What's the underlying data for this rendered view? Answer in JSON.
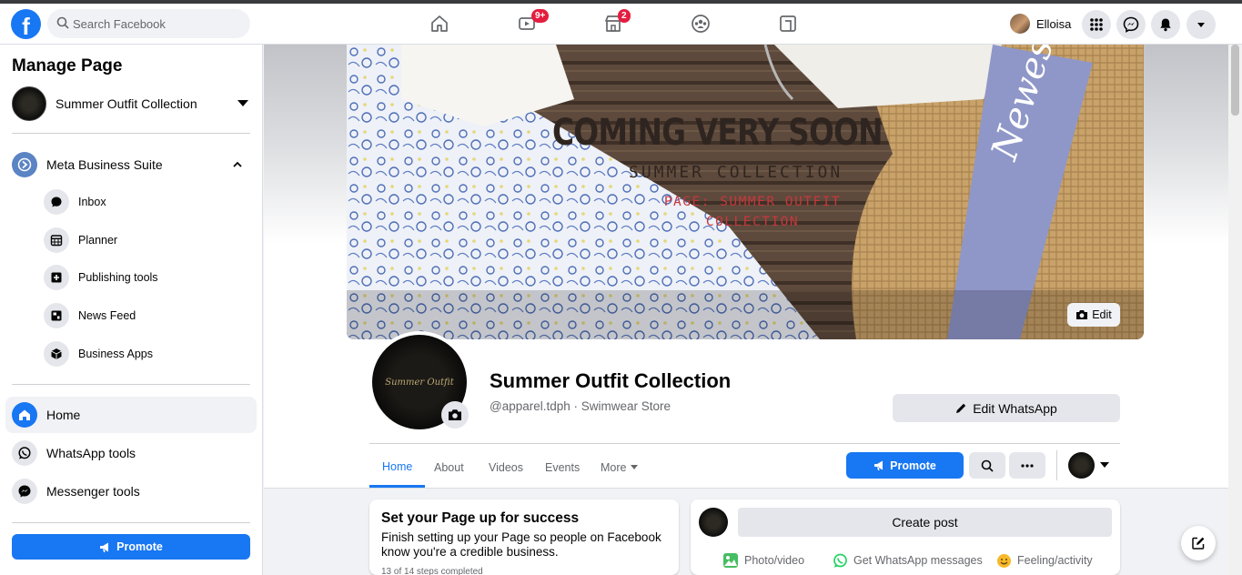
{
  "topbar": {
    "search_placeholder": "Search Facebook",
    "badges": {
      "watch": "9+",
      "marketplace": "2"
    },
    "user_name": "Elloisa"
  },
  "sidebar": {
    "title": "Manage Page",
    "page_name": "Summer Outfit Collection",
    "business_suite": "Meta Business Suite",
    "suite_items": [
      {
        "label": "Inbox",
        "icon": "chat-bubble-icon"
      },
      {
        "label": "Planner",
        "icon": "calendar-icon"
      },
      {
        "label": "Publishing tools",
        "icon": "publishing-icon"
      },
      {
        "label": "News Feed",
        "icon": "news-feed-icon"
      },
      {
        "label": "Business Apps",
        "icon": "cube-icon"
      }
    ],
    "menu": [
      {
        "label": "Home",
        "icon": "home-icon",
        "active": true
      },
      {
        "label": "WhatsApp tools",
        "icon": "whatsapp-icon"
      },
      {
        "label": "Messenger tools",
        "icon": "messenger-icon"
      }
    ],
    "promote": "Promote"
  },
  "cover": {
    "headline": "COMING VERY SOON",
    "subline": "SUMMER COLLECTION",
    "page_line": "PAGE: SUMMER OUTFIT COLLECTION",
    "band_text": "Newest Collection",
    "edit": "Edit"
  },
  "profile": {
    "logo_text": "Summer Outfit",
    "name": "Summer Outfit Collection",
    "handle": "@apparel.tdph · Swimwear Store",
    "edit_whatsapp": "Edit WhatsApp"
  },
  "tabs": {
    "home": "Home",
    "about": "About",
    "videos": "Videos",
    "events": "Events",
    "more": "More"
  },
  "actions": {
    "promote": "Promote"
  },
  "setup": {
    "title": "Set your Page up for success",
    "desc": "Finish setting up your Page so people on Facebook know you're a credible business.",
    "steps": "13 of 14 steps completed"
  },
  "composer": {
    "create_post": "Create post",
    "photo": "Photo/video",
    "whatsapp": "Get WhatsApp messages",
    "feeling": "Feeling/activity"
  },
  "colors": {
    "accent": "#1877f2",
    "band": "#8f97c8",
    "badge": "#e41e3f"
  }
}
